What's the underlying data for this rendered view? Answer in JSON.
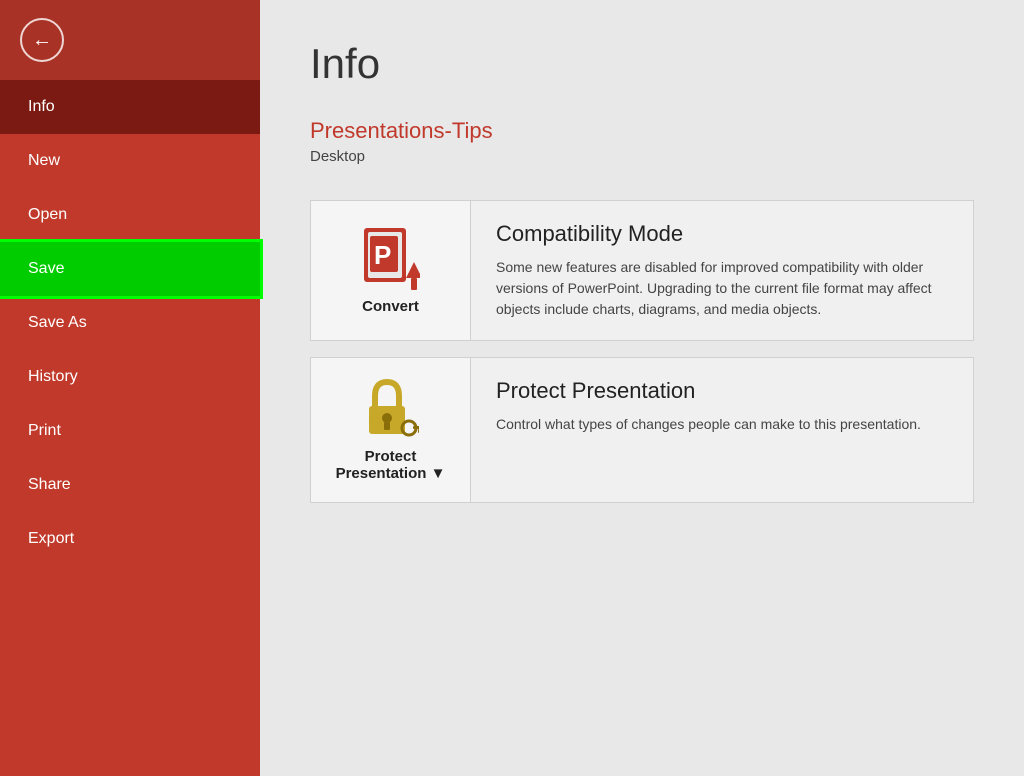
{
  "sidebar": {
    "items": [
      {
        "id": "info",
        "label": "Info",
        "active": true
      },
      {
        "id": "new",
        "label": "New",
        "active": false
      },
      {
        "id": "open",
        "label": "Open",
        "active": false
      },
      {
        "id": "save",
        "label": "Save",
        "active": false,
        "highlighted": true
      },
      {
        "id": "save-as",
        "label": "Save As",
        "active": false
      },
      {
        "id": "history",
        "label": "History",
        "active": false
      },
      {
        "id": "print",
        "label": "Print",
        "active": false
      },
      {
        "id": "share",
        "label": "Share",
        "active": false
      },
      {
        "id": "export",
        "label": "Export",
        "active": false
      }
    ]
  },
  "main": {
    "page_title": "Info",
    "file_name": "Presentations-Tips",
    "file_location": "Desktop",
    "cards": [
      {
        "id": "convert",
        "icon_label": "Convert",
        "title": "Compatibility Mode",
        "description": "Some new features are disabled for improved compatibility with older versions of PowerPoint. Upgrading to the current file format may affect objects include charts, diagrams, and media objects."
      },
      {
        "id": "protect",
        "icon_label": "Protect\nPresentation",
        "title": "Protect Presentation",
        "description": "Control what types of changes people can make to this presentation."
      }
    ]
  },
  "colors": {
    "sidebar_bg": "#c0392b",
    "sidebar_active": "#7b1a12",
    "save_highlight": "#00cc00",
    "accent": "#c0392b",
    "main_bg": "#e8e8e8"
  }
}
